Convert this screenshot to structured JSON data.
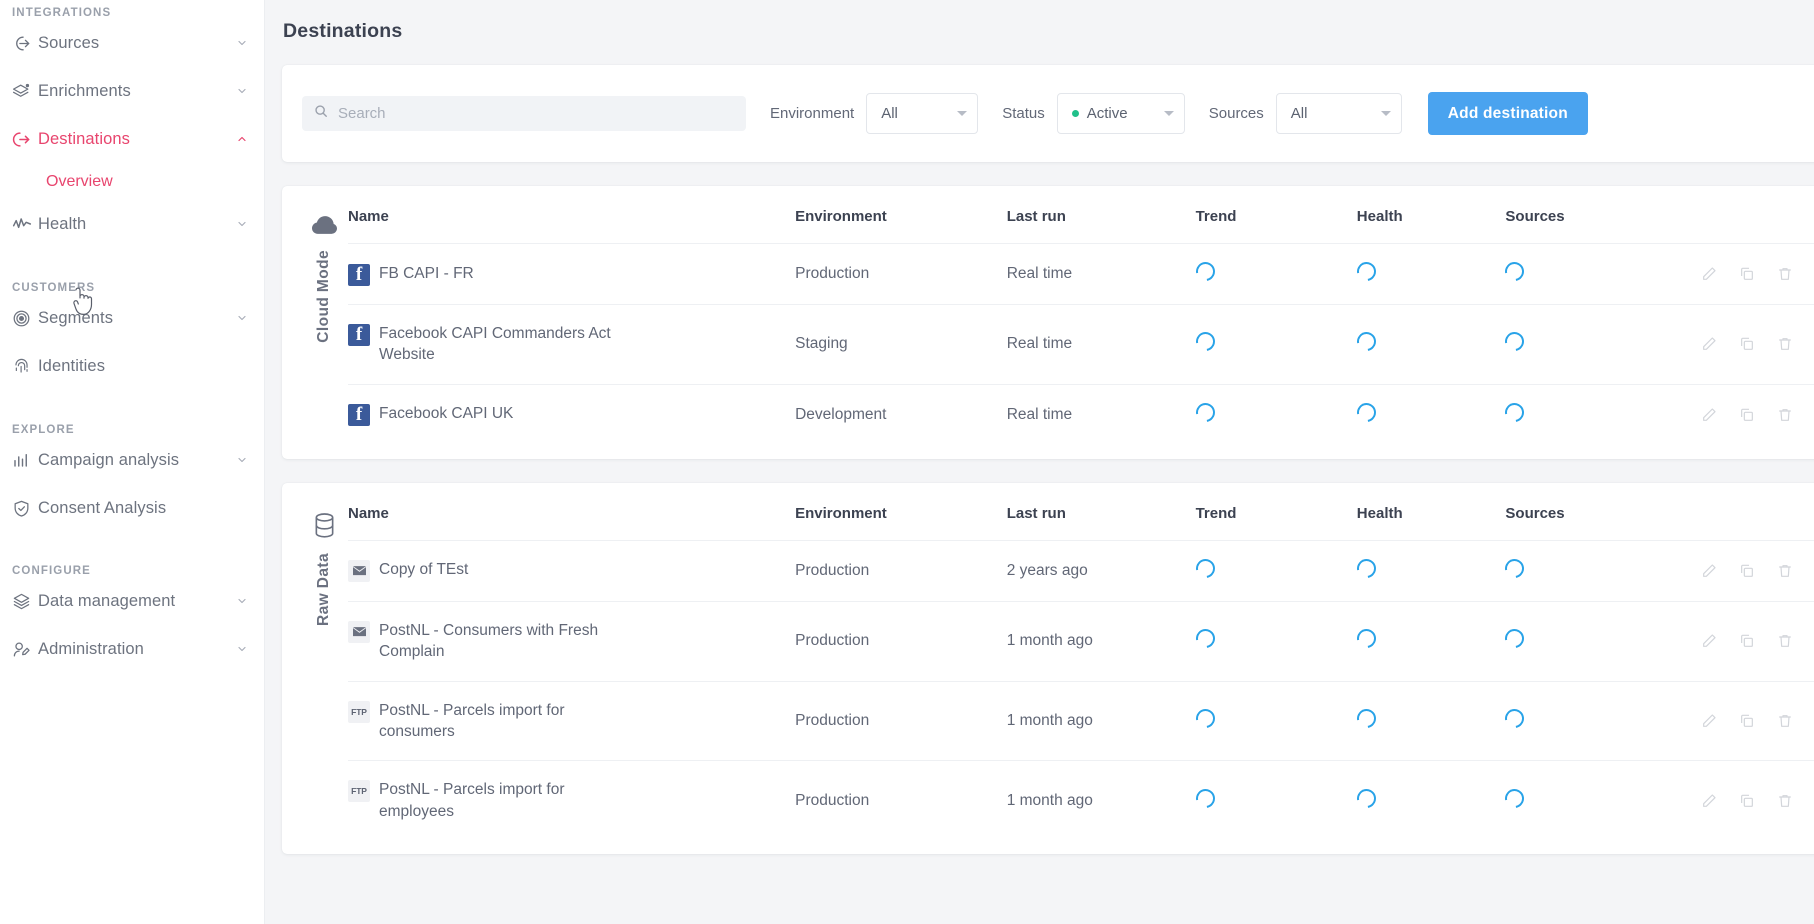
{
  "sidebar": {
    "sections": [
      {
        "label": "INTEGRATIONS"
      },
      {
        "label": "CUSTOMERS"
      },
      {
        "label": "EXPLORE"
      },
      {
        "label": "CONFIGURE"
      }
    ],
    "items": [
      {
        "label": "Sources",
        "icon": "sources-icon",
        "chevron": "chevron-down"
      },
      {
        "label": "Enrichments",
        "icon": "enrichments-icon",
        "chevron": "chevron-down"
      },
      {
        "label": "Destinations",
        "icon": "destinations-icon",
        "chevron": "chevron-up",
        "active": true
      },
      {
        "label": "Overview",
        "icon": "",
        "chevron": ""
      },
      {
        "label": "Health",
        "icon": "health-icon",
        "chevron": "chevron-down"
      },
      {
        "label": "Segments",
        "icon": "segments-icon",
        "chevron": "chevron-down"
      },
      {
        "label": "Identities",
        "icon": "identities-icon",
        "chevron": ""
      },
      {
        "label": "Campaign analysis",
        "icon": "bar-chart-icon",
        "chevron": "chevron-down"
      },
      {
        "label": "Consent Analysis",
        "icon": "shield-check-icon",
        "chevron": ""
      },
      {
        "label": "Data management",
        "icon": "layers-icon",
        "chevron": "chevron-down"
      },
      {
        "label": "Administration",
        "icon": "administration-icon",
        "chevron": "chevron-down"
      }
    ],
    "accent_color": "#e8456e"
  },
  "header": {
    "title": "Destinations"
  },
  "filters": {
    "search": {
      "placeholder": "Search",
      "value": ""
    },
    "environment": {
      "label": "Environment",
      "value": "All"
    },
    "status": {
      "label": "Status",
      "value": "Active",
      "dot_color": "#21c08a"
    },
    "sources": {
      "label": "Sources",
      "value": "All"
    },
    "add_button": {
      "label": "Add destination",
      "color": "#4aa3ef"
    }
  },
  "columns": [
    "Name",
    "Environment",
    "Last run",
    "Trend",
    "Health",
    "Sources"
  ],
  "groups": [
    {
      "label": "Cloud Mode",
      "icon": "cloud-icon",
      "rows": [
        {
          "icon": "facebook-icon",
          "name": "FB CAPI - FR",
          "environment": "Production",
          "last_run": "Real time",
          "trend": "loading",
          "health": "loading",
          "sources": "loading"
        },
        {
          "icon": "facebook-icon",
          "name": "Facebook CAPI Commanders Act Website",
          "environment": "Staging",
          "last_run": "Real time",
          "trend": "loading",
          "health": "loading",
          "sources": "loading"
        },
        {
          "icon": "facebook-icon",
          "name": "Facebook CAPI UK",
          "environment": "Development",
          "last_run": "Real time",
          "trend": "loading",
          "health": "loading",
          "sources": "loading"
        }
      ]
    },
    {
      "label": "Raw Data",
      "icon": "database-icon",
      "rows": [
        {
          "icon": "mail-icon",
          "name": "Copy of TEst",
          "environment": "Production",
          "last_run": "2 years ago",
          "trend": "loading",
          "health": "loading",
          "sources": "loading"
        },
        {
          "icon": "mail-icon",
          "name": "PostNL - Consumers with Fresh Complain",
          "environment": "Production",
          "last_run": "1 month ago",
          "trend": "loading",
          "health": "loading",
          "sources": "loading"
        },
        {
          "icon": "ftp-icon",
          "icon_text": "FTP",
          "name": "PostNL - Parcels import for consumers",
          "environment": "Production",
          "last_run": "1 month ago",
          "trend": "loading",
          "health": "loading",
          "sources": "loading"
        },
        {
          "icon": "ftp-icon",
          "icon_text": "FTP",
          "name": "PostNL - Parcels import for employees",
          "environment": "Production",
          "last_run": "1 month ago",
          "trend": "loading",
          "health": "loading",
          "sources": "loading"
        }
      ]
    }
  ],
  "row_actions": [
    {
      "name": "edit-icon",
      "title": "Edit"
    },
    {
      "name": "duplicate-icon",
      "title": "Duplicate"
    },
    {
      "name": "delete-icon",
      "title": "Delete"
    }
  ]
}
